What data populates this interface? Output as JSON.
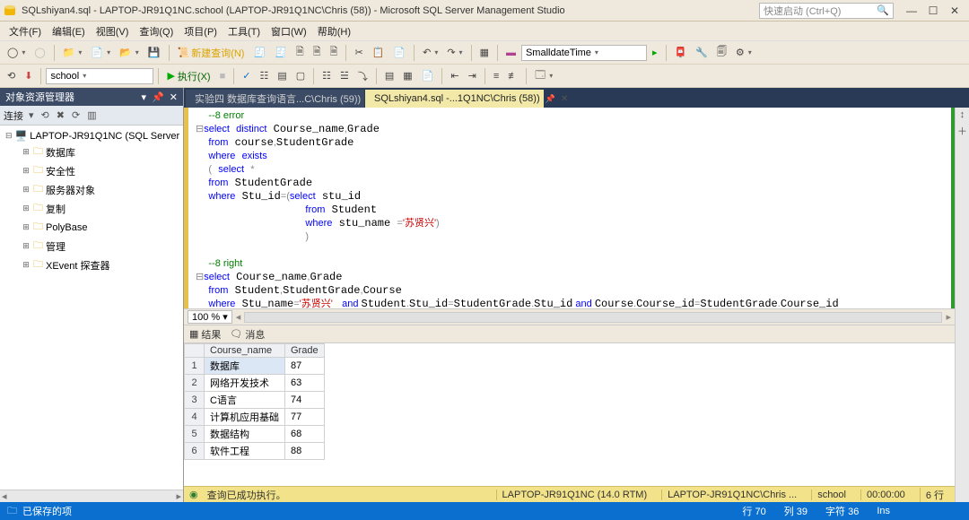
{
  "title": "SQLshiyan4.sql - LAPTOP-JR91Q1NC.school (LAPTOP-JR91Q1NC\\Chris (58)) - Microsoft SQL Server Management Studio",
  "quick_launch_placeholder": "快速启动 (Ctrl+Q)",
  "menu": [
    "文件(F)",
    "编辑(E)",
    "视图(V)",
    "查询(Q)",
    "项目(P)",
    "工具(T)",
    "窗口(W)",
    "帮助(H)"
  ],
  "toolbar1": {
    "new_query": "新建查询(N)",
    "datetype": "SmalldateTime"
  },
  "toolbar2": {
    "db_selected": "school",
    "execute": "执行(X)"
  },
  "object_explorer": {
    "title": "对象资源管理器",
    "connect": "连接",
    "root": "LAPTOP-JR91Q1NC (SQL Server 14.0.",
    "nodes": [
      "数据库",
      "安全性",
      "服务器对象",
      "复制",
      "PolyBase",
      "管理",
      "XEvent 探查器"
    ]
  },
  "tabs": [
    {
      "label": "实验四 数据库查询语言...C\\Chris (59))",
      "active": false
    },
    {
      "label": "SQLshiyan4.sql -...1Q1NC\\Chris (58))",
      "active": true
    }
  ],
  "code_lines": [
    {
      "t": "cm",
      "text": "--8 error"
    },
    {
      "t": "sql1",
      "prefix": "⊟"
    },
    {
      "t": "from1"
    },
    {
      "t": "where_exists"
    },
    {
      "t": "subsel"
    },
    {
      "t": "from_sg"
    },
    {
      "t": "where_stuid"
    },
    {
      "t": "from_student"
    },
    {
      "t": "where_stuname"
    },
    {
      "t": "paren"
    },
    {
      "t": "cm",
      "text": "--8 right"
    },
    {
      "t": "sql2",
      "prefix": "⊟"
    },
    {
      "t": "from2"
    },
    {
      "t": "where2"
    }
  ],
  "zoom": "100 %",
  "result_tabs": {
    "results": "结果",
    "messages": "消息"
  },
  "grid": {
    "columns": [
      "Course_name",
      "Grade"
    ],
    "rows": [
      [
        "数据库",
        "87"
      ],
      [
        "网络开发技术",
        "63"
      ],
      [
        "C语言",
        "74"
      ],
      [
        "计算机应用基础",
        "77"
      ],
      [
        "数据结构",
        "68"
      ],
      [
        "软件工程",
        "88"
      ]
    ]
  },
  "status_yellow": {
    "msg": "查询已成功执行。",
    "server": "LAPTOP-JR91Q1NC (14.0 RTM)",
    "user": "LAPTOP-JR91Q1NC\\Chris ...",
    "db": "school",
    "time": "00:00:00",
    "rows": "6 行"
  },
  "status_blue": {
    "saved": "已保存的项",
    "line": "行 70",
    "col": "列 39",
    "char": "字符 36",
    "ins": "Ins"
  }
}
